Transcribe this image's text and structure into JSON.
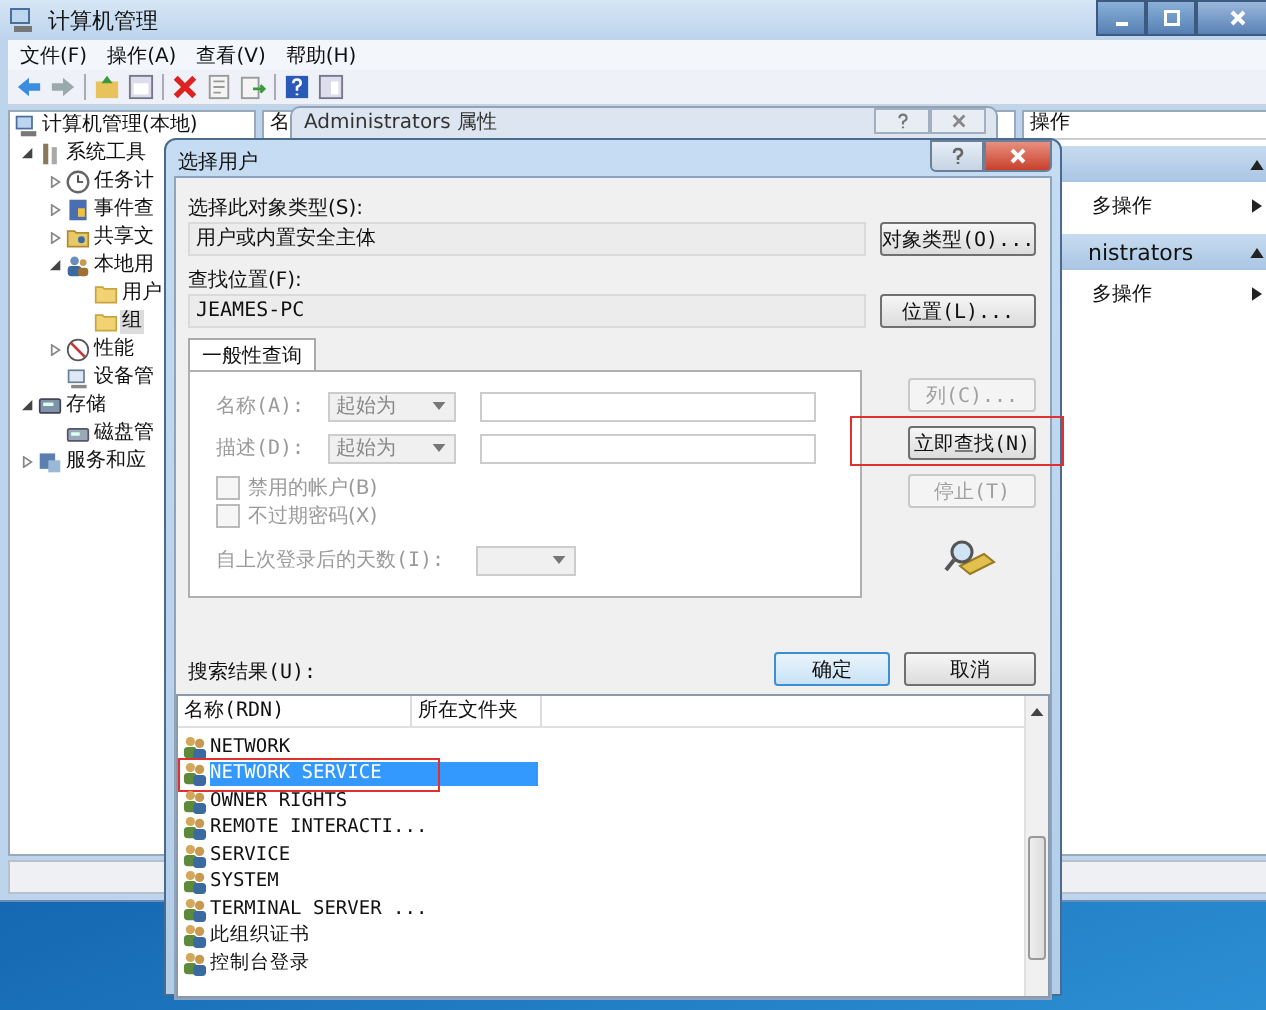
{
  "main_window": {
    "title": "计算机管理",
    "menu": [
      "文件(F)",
      "操作(A)",
      "查看(V)",
      "帮助(H)"
    ],
    "tree": [
      {
        "label": "计算机管理(本地)",
        "kind": "computer",
        "selected": false,
        "children": [
          {
            "label": "系统工具",
            "kind": "tools",
            "expanded": true,
            "selected": false,
            "children": [
              {
                "label": "任务计",
                "kind": "clock",
                "expanded": false,
                "selected": false
              },
              {
                "label": "事件查",
                "kind": "event",
                "expanded": false,
                "selected": false
              },
              {
                "label": "共享文",
                "kind": "share",
                "expanded": false,
                "selected": false
              },
              {
                "label": "本地用",
                "kind": "users",
                "expanded": true,
                "selected": false,
                "children": [
                  {
                    "label": "用户",
                    "kind": "folder",
                    "selected": false
                  },
                  {
                    "label": "组",
                    "kind": "folder",
                    "selected": true
                  }
                ]
              },
              {
                "label": "性能",
                "kind": "perf",
                "expanded": false,
                "selected": false
              },
              {
                "label": "设备管",
                "kind": "device",
                "selected": false
              }
            ]
          },
          {
            "label": "存储",
            "kind": "storage",
            "expanded": true,
            "selected": false,
            "children": [
              {
                "label": "磁盘管",
                "kind": "disk",
                "selected": false
              }
            ]
          },
          {
            "label": "服务和应",
            "kind": "services",
            "expanded": false,
            "selected": false
          }
        ]
      }
    ],
    "middle_column": "名",
    "actions": {
      "title": "操作",
      "sections": [
        {
          "items": [
            "多操作"
          ]
        },
        {
          "heading": "nistrators",
          "items": [
            "多操作"
          ]
        }
      ]
    }
  },
  "properties_window": {
    "title": "Administrators 属性"
  },
  "dialog": {
    "title": "选择用户",
    "object_type": {
      "label": "选择此对象类型(S):",
      "value": "用户或内置安全主体",
      "button": "对象类型(O)..."
    },
    "location": {
      "label": "查找位置(F):",
      "value": "JEAMES-PC",
      "button": "位置(L)..."
    },
    "tabs": [
      {
        "label": "一般性查询",
        "selected": true
      }
    ],
    "query": {
      "disabled": true,
      "fields": [
        {
          "label": "名称(A):",
          "option": "起始为"
        },
        {
          "label": "描述(D):",
          "option": "起始为"
        }
      ],
      "checkboxes": [
        {
          "label": "禁用的帐户(B)",
          "checked": false
        },
        {
          "label": "不过期密码(X)",
          "checked": false
        }
      ],
      "days_label": "自上次登录后的天数(I):"
    },
    "side_buttons": [
      {
        "label": "列(C)...",
        "disabled": true,
        "highlighted": false
      },
      {
        "label": "立即查找(N)",
        "disabled": false,
        "highlighted": true
      },
      {
        "label": "停止(T)",
        "disabled": true,
        "highlighted": false
      }
    ],
    "ok": "确定",
    "cancel": "取消",
    "results_label": "搜索结果(U):",
    "results": {
      "columns": [
        "名称(RDN)",
        "所在文件夹"
      ],
      "rows": [
        {
          "name": "NETWORK",
          "selected": false,
          "highlighted": false
        },
        {
          "name": "NETWORK SERVICE",
          "selected": true,
          "highlighted": true
        },
        {
          "name": "OWNER RIGHTS",
          "selected": false,
          "highlighted": false
        },
        {
          "name": "REMOTE INTERACTI...",
          "selected": false,
          "highlighted": false
        },
        {
          "name": "SERVICE",
          "selected": false,
          "highlighted": false
        },
        {
          "name": "SYSTEM",
          "selected": false,
          "highlighted": false
        },
        {
          "name": "TERMINAL SERVER ...",
          "selected": false,
          "highlighted": false
        },
        {
          "name": "此组织证书",
          "selected": false,
          "highlighted": false
        },
        {
          "name": "控制台登录",
          "selected": false,
          "highlighted": false
        }
      ]
    }
  }
}
